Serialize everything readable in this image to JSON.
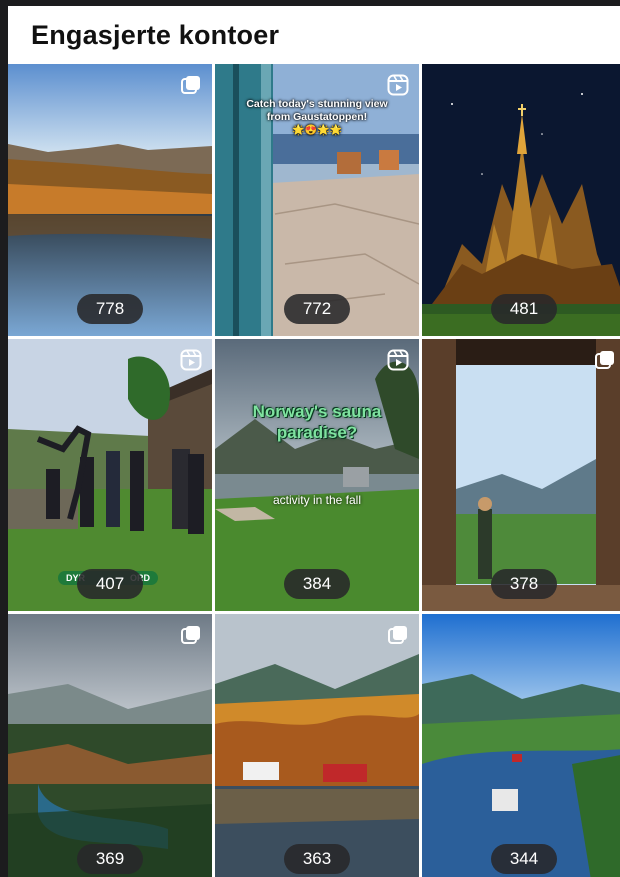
{
  "page": {
    "title": "Engasjerte kontoer"
  },
  "posts": [
    {
      "count": "778",
      "type": "carousel"
    },
    {
      "count": "772",
      "type": "reel",
      "caption": "Catch today's stunning view from Gaustatoppen!",
      "caption_emoji": "🌟😍🌟🌟"
    },
    {
      "count": "481",
      "type": "none"
    },
    {
      "count": "407",
      "type": "reel",
      "banner_left": "DYR",
      "banner_right": "ORD"
    },
    {
      "count": "384",
      "type": "reel",
      "caption_line1": "Norway's sauna",
      "caption_line2": "paradise?",
      "subcaption": "activity in the fall"
    },
    {
      "count": "378",
      "type": "carousel"
    },
    {
      "count": "369",
      "type": "carousel"
    },
    {
      "count": "363",
      "type": "carousel"
    },
    {
      "count": "344",
      "type": "none"
    }
  ]
}
